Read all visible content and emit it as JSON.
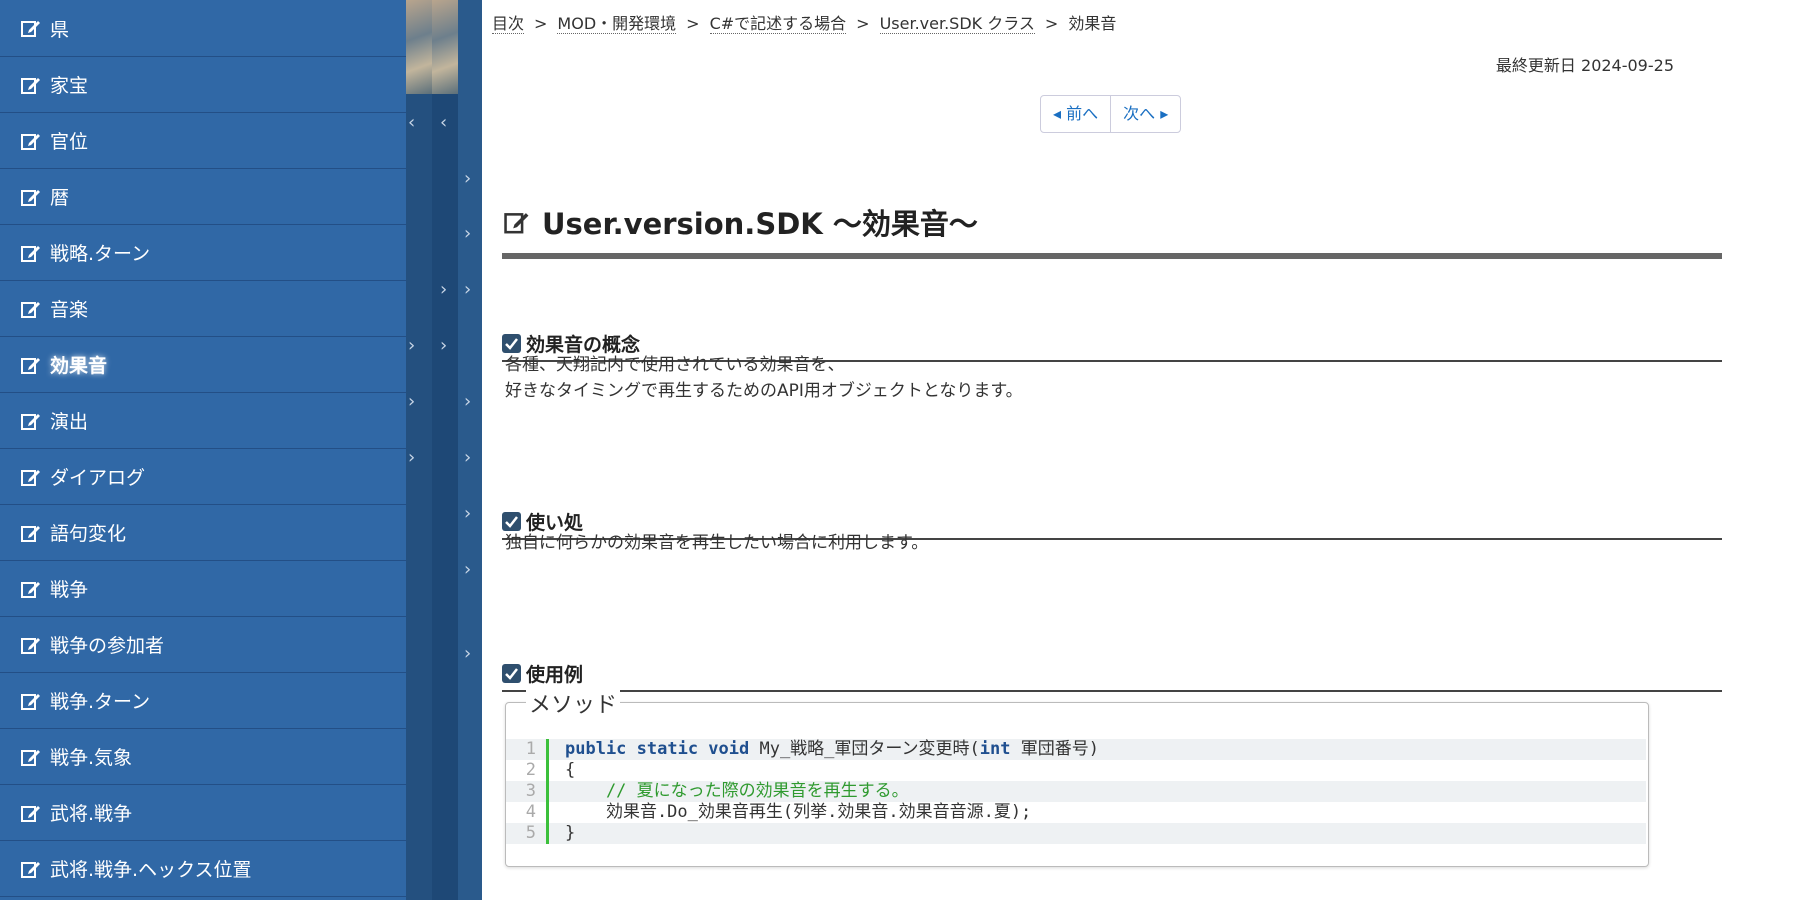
{
  "sidebar": {
    "items": [
      {
        "label": "県"
      },
      {
        "label": "家宝"
      },
      {
        "label": "官位"
      },
      {
        "label": "暦"
      },
      {
        "label": "戦略.ターン"
      },
      {
        "label": "音楽"
      },
      {
        "label": "効果音",
        "active": true
      },
      {
        "label": "演出"
      },
      {
        "label": "ダイアログ"
      },
      {
        "label": "語句変化"
      },
      {
        "label": "戦争"
      },
      {
        "label": "戦争の参加者"
      },
      {
        "label": "戦争.ターン"
      },
      {
        "label": "戦争.気象"
      },
      {
        "label": "武将.戦争"
      },
      {
        "label": "武将.戦争.ヘックス位置"
      }
    ]
  },
  "breadcrumb": {
    "items": [
      "目次",
      "MOD・開発環境",
      "C#で記述する場合",
      "User.ver.SDK クラス"
    ],
    "current": "効果音",
    "separator": ">"
  },
  "updated": "最終更新日 2024-09-25",
  "pager": {
    "prev": "前へ",
    "next": "次へ"
  },
  "page_title": "User.version.SDK ～効果音～",
  "sections": {
    "concept": {
      "heading": "効果音の概念",
      "lines": [
        "各種、天翔記内で使用されている効果音を、",
        "好きなタイミングで再生するためのAPI用オブジェクトとなります。"
      ]
    },
    "usage": {
      "heading": "使い処",
      "lines": [
        "独自に何らかの効果音を再生したい場合に利用します。"
      ]
    },
    "example": {
      "heading": "使用例",
      "legend": "メソッド",
      "code": {
        "line_numbers": [
          "1",
          "2",
          "3",
          "4",
          "5"
        ],
        "l1_kw": "public static void",
        "l1_rest": " My_戦略_軍団ターン変更時(",
        "l1_kw2": "int",
        "l1_end": " 軍団番号)",
        "l2": "{",
        "l3": "    // 夏になった際の効果音を再生する。",
        "l4": "    効果音.Do_効果音再生(列挙.効果音.効果音音源.夏);",
        "l5": "}"
      }
    }
  },
  "colors": {
    "sidebar": "#3068a6",
    "accent": "#1a6fc2",
    "code_bar": "#3bc03b"
  },
  "icons": {
    "sidebar_item": "edit-icon",
    "heading": "checkbox-icon"
  }
}
